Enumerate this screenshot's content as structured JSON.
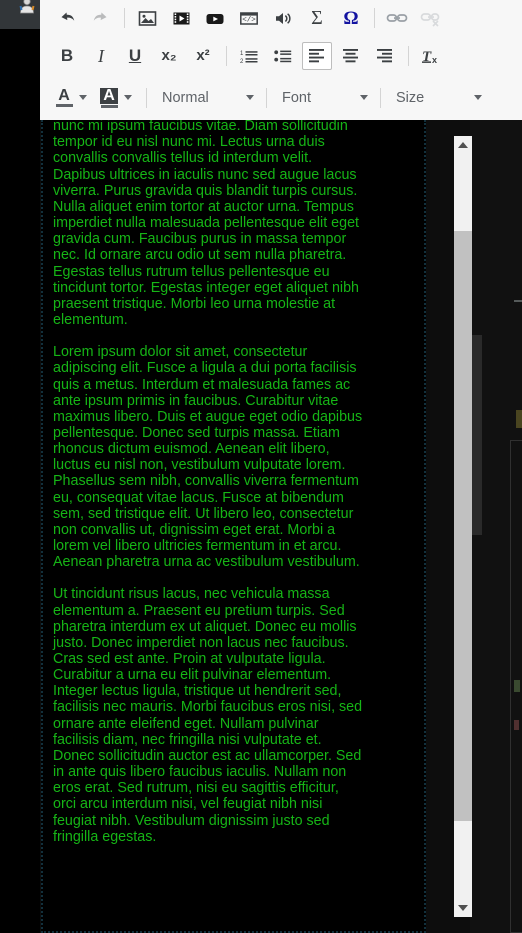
{
  "chrome": {
    "avatar_icon": "user-avatar-icon"
  },
  "toolbar": {
    "row1": [
      {
        "name": "undo-button",
        "icon": "undo-arrow-icon",
        "label": "Undo",
        "disabled": false
      },
      {
        "name": "redo-button",
        "icon": "redo-arrow-icon",
        "label": "Redo",
        "disabled": true
      },
      {
        "name": "insert-image-button",
        "icon": "image-icon",
        "label": "Insert image",
        "disabled": false
      },
      {
        "name": "insert-video-button",
        "icon": "film-strip-icon",
        "label": "Insert video",
        "disabled": false
      },
      {
        "name": "insert-youtube-button",
        "icon": "youtube-icon",
        "label": "Insert YouTube video",
        "disabled": false
      },
      {
        "name": "insert-code-button",
        "icon": "code-block-icon",
        "label": "Insert code block",
        "disabled": false
      },
      {
        "name": "insert-audio-button",
        "icon": "speaker-icon",
        "label": "Insert audio",
        "disabled": false
      },
      {
        "name": "insert-math-button",
        "icon": "sigma-icon",
        "label": "Insert math",
        "disabled": false
      },
      {
        "name": "insert-special-char-button",
        "icon": "omega-icon",
        "label": "Special character",
        "disabled": false
      },
      {
        "name": "insert-link-button",
        "icon": "link-icon",
        "label": "Insert link",
        "disabled": false
      },
      {
        "name": "remove-link-button",
        "icon": "unlink-icon",
        "label": "Remove link",
        "disabled": true
      }
    ],
    "row2": [
      {
        "name": "bold-button",
        "glyph": "B",
        "label": "Bold"
      },
      {
        "name": "italic-button",
        "glyph": "I",
        "label": "Italic"
      },
      {
        "name": "underline-button",
        "glyph": "U",
        "label": "Underline"
      },
      {
        "name": "subscript-button",
        "glyph": "x₂",
        "label": "Subscript"
      },
      {
        "name": "superscript-button",
        "glyph": "x²",
        "label": "Superscript"
      },
      {
        "name": "numbered-list-button",
        "icon": "numbered-list-icon",
        "label": "Numbered list"
      },
      {
        "name": "bulleted-list-button",
        "icon": "bulleted-list-icon",
        "label": "Bulleted list"
      },
      {
        "name": "align-left-button",
        "icon": "align-left-icon",
        "label": "Align left",
        "active": true
      },
      {
        "name": "align-center-button",
        "icon": "align-center-icon",
        "label": "Align center"
      },
      {
        "name": "align-right-button",
        "icon": "align-right-icon",
        "label": "Align right"
      },
      {
        "name": "clear-formatting-button",
        "icon": "clear-formatting-icon",
        "label": "Remove formatting"
      }
    ],
    "text_color_label": "A",
    "bg_color_label": "A",
    "style_dropdown": "Normal",
    "font_dropdown": "Font",
    "size_dropdown": "Size"
  },
  "editor": {
    "text_color": "#16b516",
    "background_color": "#000000",
    "paragraphs": [
      "dictum non consectetur a erat. Tempor id eu nisl nunc mi ipsum faucibus vitae. Diam sollicitudin tempor id eu nisl nunc mi. Lectus urna duis convallis convallis tellus id interdum velit. Dapibus ultrices in iaculis nunc sed augue lacus viverra. Purus gravida quis blandit turpis cursus. Nulla aliquet enim tortor at auctor urna. Tempus imperdiet nulla malesuada pellentesque elit eget gravida cum. Faucibus purus in massa tempor nec. Id ornare arcu odio ut sem nulla pharetra. Egestas tellus rutrum tellus pellentesque eu tincidunt tortor. Egestas integer eget aliquet nibh praesent tristique. Morbi leo urna molestie at elementum.",
      "Lorem ipsum dolor sit amet, consectetur adipiscing elit. Fusce a ligula a dui porta facilisis quis a metus. Interdum et malesuada fames ac ante ipsum primis in faucibus. Curabitur vitae maximus libero. Duis et augue eget odio dapibus pellentesque. Donec sed turpis massa. Etiam rhoncus dictum euismod. Aenean elit libero, luctus eu nisl non, vestibulum vulputate lorem. Phasellus sem nibh, convallis viverra fermentum eu, consequat vitae lacus. Fusce at bibendum sem, sed tristique elit. Ut libero leo, consectetur non convallis ut, dignissim eget erat. Morbi a lorem vel libero ultricies fermentum in et arcu. Aenean pharetra urna ac vestibulum vestibulum.",
      "Ut tincidunt risus lacus, nec vehicula massa elementum a. Praesent eu pretium turpis. Sed pharetra interdum ex ut aliquet. Donec eu mollis justo. Donec imperdiet non lacus nec faucibus. Cras sed est ante. Proin at vulputate ligula. Curabitur a urna eu elit pulvinar elementum. Integer lectus ligula, tristique ut hendrerit sed, facilisis nec mauris. Morbi faucibus eros nisi, sed ornare ante eleifend eget. Nullam pulvinar facilisis diam, nec fringilla nisi vulputate et. Donec sollicitudin auctor est ac ullamcorper. Sed in ante quis libero faucibus iaculis. Nullam non eros erat. Sed rutrum, nisi eu sagittis efficitur, orci arcu interdum nisi, vel feugiat nibh nisi feugiat nibh. Vestibulum dignissim justo sed fringilla egestas."
    ]
  },
  "scrollbar": {
    "up_arrow_icon": "triangle-up-icon",
    "down_arrow_icon": "triangle-down-icon",
    "thumb_name": "scrollbar-thumb"
  }
}
